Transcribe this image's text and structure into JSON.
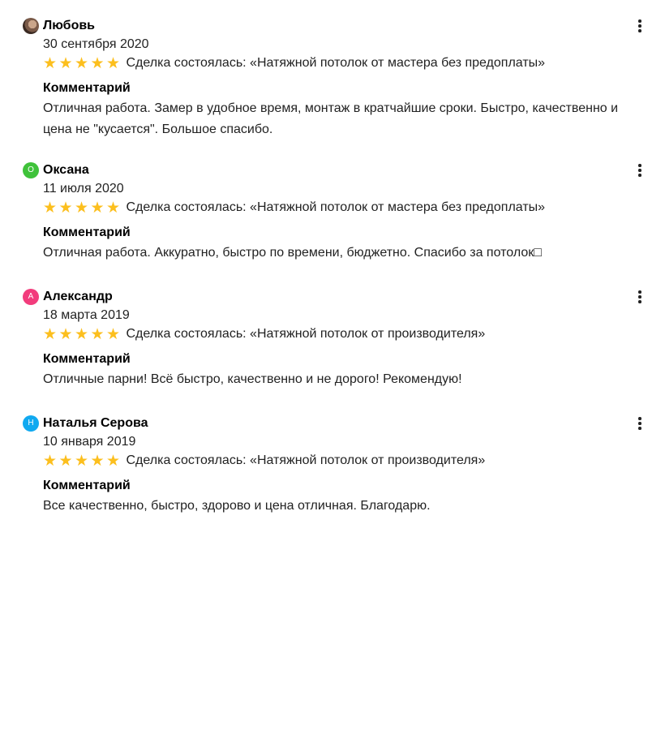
{
  "comment_heading": "Комментарий",
  "star_glyph": "★",
  "reviews": [
    {
      "author": "Любовь",
      "avatar_letter": "",
      "avatar_kind": "photo",
      "avatar_color": "#7a5a48",
      "date": "30 сентября 2020",
      "rating": 5,
      "deal": "Сделка состоялась: «Натяжной потолок от мастера без предоплаты»",
      "comment": "Отличная работа. Замер в удобное время, монтаж в кратчайшие сроки. Быстро, качественно и цена не \"кусается\". Большое спасибо."
    },
    {
      "author": "Оксана",
      "avatar_letter": "О",
      "avatar_kind": "letter",
      "avatar_color": "#3fc23a",
      "date": "11 июля 2020",
      "rating": 5,
      "deal": "Сделка состоялась: «Натяжной потолок от мастера без предоплаты»",
      "comment": "Отличная работа. Аккуратно, быстро по времени, бюджетно. Спасибо за потолок□"
    },
    {
      "author": "Александр",
      "avatar_letter": "А",
      "avatar_kind": "letter",
      "avatar_color": "#f23c7c",
      "date": "18 марта 2019",
      "rating": 5,
      "deal": "Сделка состоялась: «Натяжной потолок от производителя»",
      "comment": "Отличные парни! Всё быстро, качественно и не дорого! Рекомендую!"
    },
    {
      "author": "Наталья Серова",
      "avatar_letter": "Н",
      "avatar_kind": "letter",
      "avatar_color": "#10a9f0",
      "date": "10 января 2019",
      "rating": 5,
      "deal": "Сделка состоялась: «Натяжной потолок от производителя»",
      "comment": "Все качественно, быстро, здорово и цена отличная. Благодарю."
    }
  ]
}
